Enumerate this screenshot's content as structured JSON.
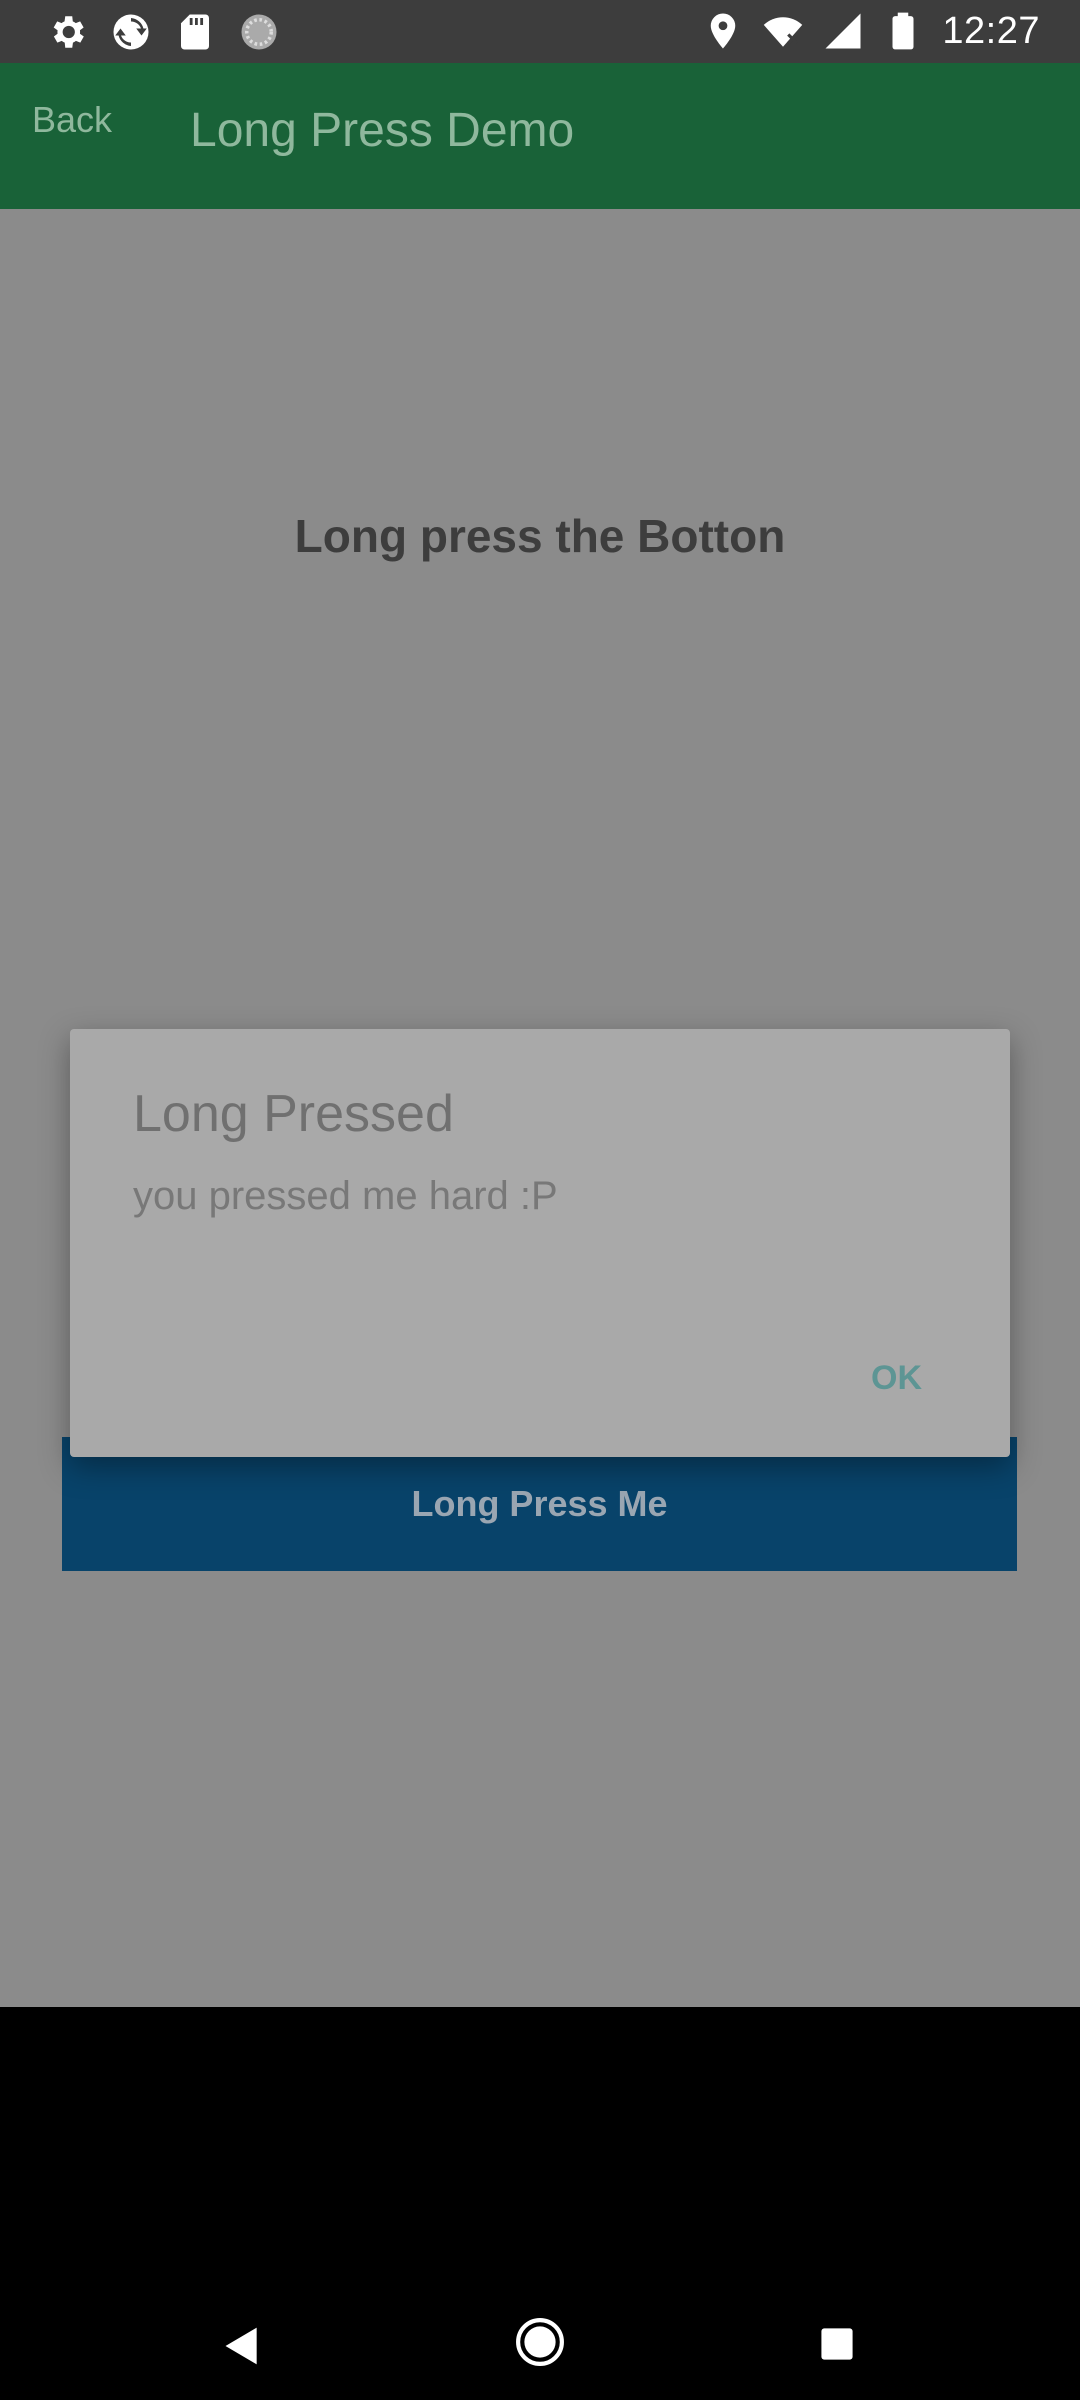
{
  "status_bar": {
    "time": "12:27",
    "left_icons": [
      "gear-icon",
      "sync-icon",
      "sd-card-icon",
      "loading-icon"
    ],
    "right_icons": [
      "location-icon",
      "wifi-icon",
      "signal-icon",
      "battery-icon"
    ]
  },
  "app_bar": {
    "back_label": "Back",
    "title": "Long Press Demo",
    "color": "#196238"
  },
  "content": {
    "instruction": "Long press the Botton",
    "button_label": "Long Press Me",
    "button_color": "#08436a"
  },
  "dialog": {
    "title": "Long Pressed",
    "message": "you pressed me hard :P",
    "ok_label": "OK"
  },
  "nav_bar": {
    "buttons": [
      "back-icon",
      "home-icon",
      "recents-icon"
    ]
  }
}
